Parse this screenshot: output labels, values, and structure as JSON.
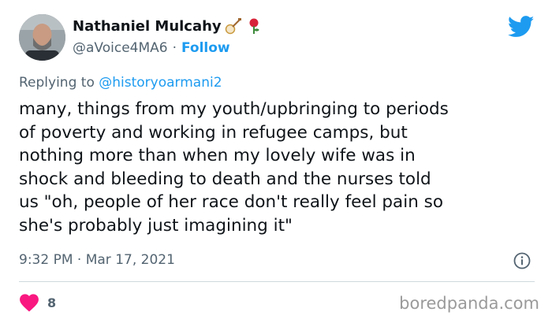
{
  "author": {
    "display_name": "Nathaniel Mulcahy",
    "handle": "@aVoice4MA6",
    "separator": "·",
    "follow_label": "Follow"
  },
  "reply": {
    "prefix": "Replying to",
    "mention": "@historyoarmani2"
  },
  "tweet": {
    "text": "many, things from my youth/upbringing to periods\nof poverty and working in refugee camps, but\nnothing more than when my lovely wife was in\nshock and bleeding to death and the nurses told\nus \"oh, people of her race don't really feel pain so\nshe's probably just imagining it\""
  },
  "meta": {
    "timestamp": "9:32 PM · Mar 17, 2021"
  },
  "engagement": {
    "like_count": "8"
  },
  "watermark": "boredpanda.com",
  "icons": {
    "brand": "twitter-bird-icon",
    "emoji_1": "banjo-icon",
    "emoji_2": "rose-icon",
    "info": "info-icon",
    "like": "heart-icon"
  },
  "colors": {
    "link": "#1d9bf0",
    "muted": "#536471",
    "heart": "#f91880",
    "text": "#0f1419",
    "divider": "#cfd9de"
  }
}
